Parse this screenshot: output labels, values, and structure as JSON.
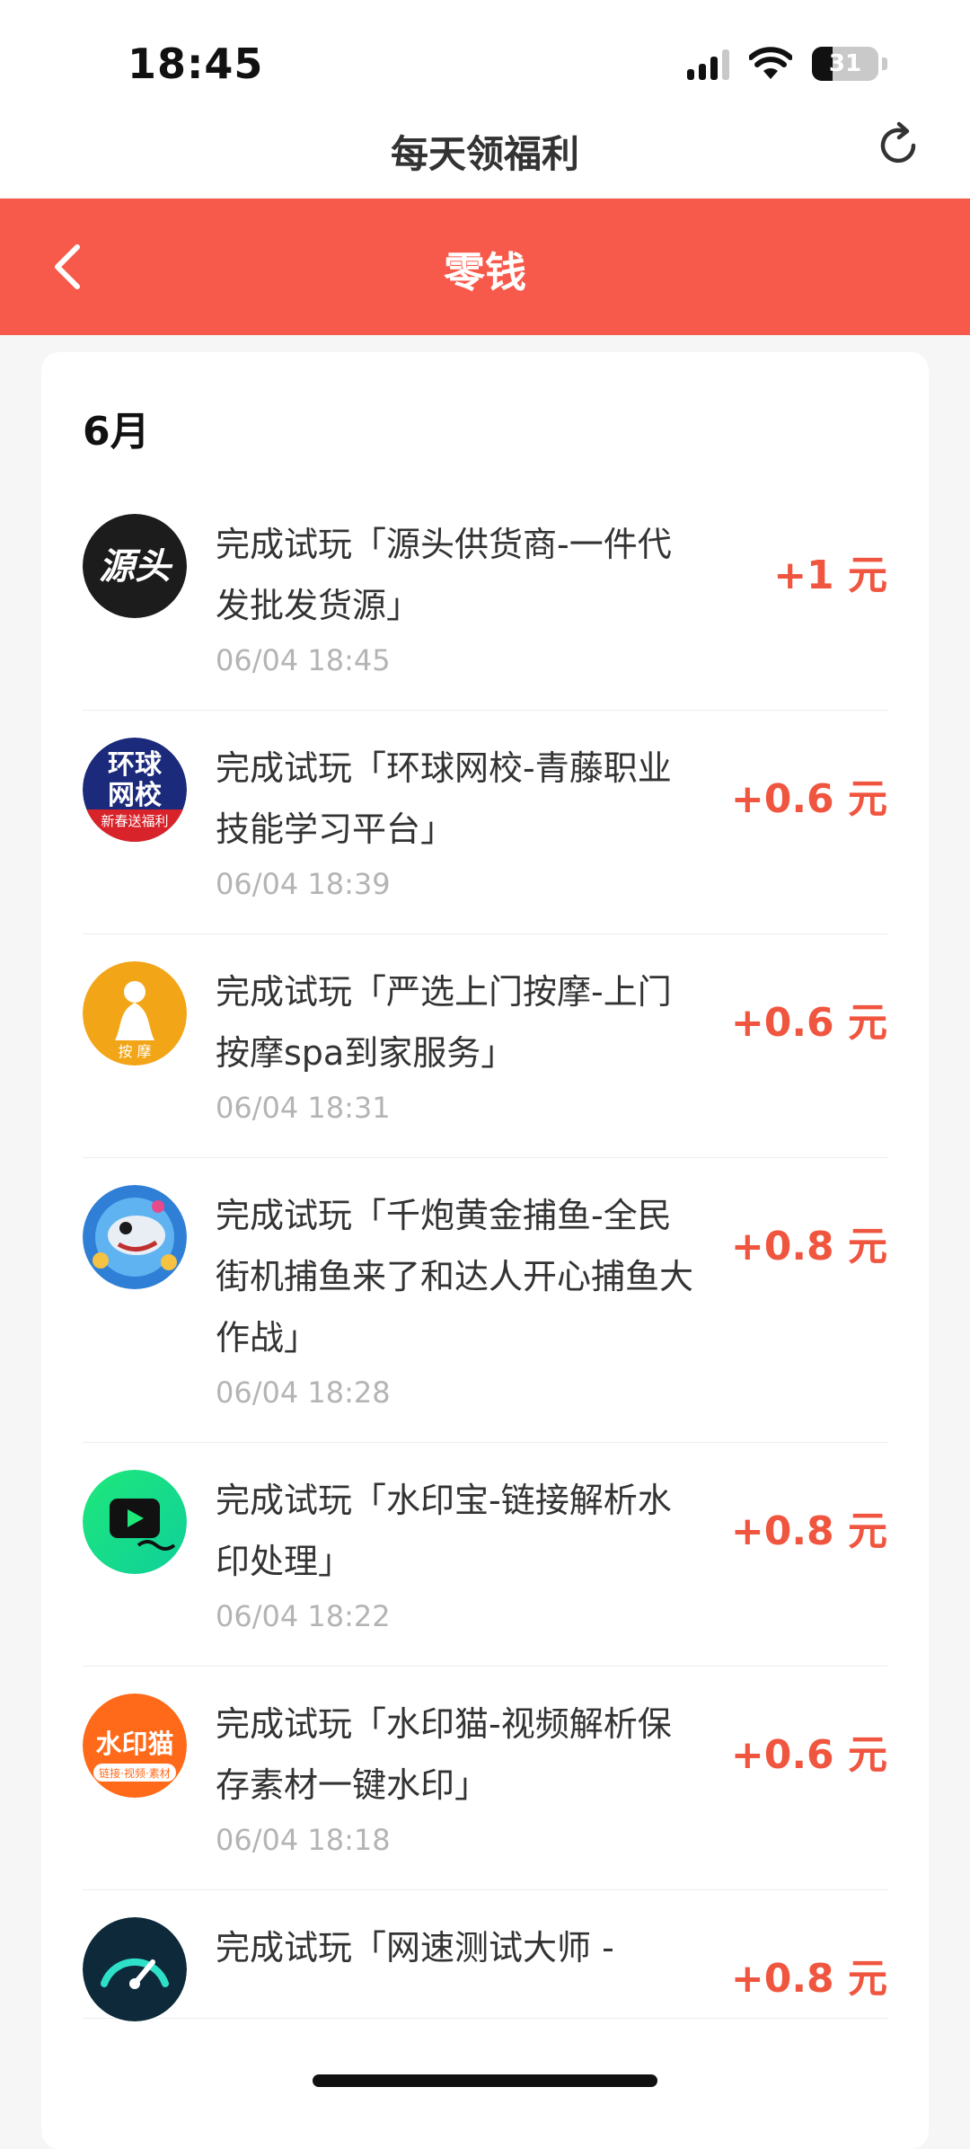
{
  "status": {
    "time": "18:45",
    "battery": "31",
    "battery_level": 0.31
  },
  "topbar": {
    "title": "每天领福利"
  },
  "header": {
    "title": "零钱",
    "color": "#f7594a"
  },
  "list": {
    "month": "6月",
    "items": [
      {
        "title": "完成试玩「源头供货商-一件代发批发货源」",
        "date": "06/04 18:45",
        "amount": "+1 元",
        "icon": "yuantou-app-icon"
      },
      {
        "title": "完成试玩「环球网校-青藤职业技能学习平台」",
        "date": "06/04 18:39",
        "amount": "+0.6 元",
        "icon": "huanqiu-wangxiao-app-icon"
      },
      {
        "title": "完成试玩「严选上门按摩-上门按摩spa到家服务」",
        "date": "06/04 18:31",
        "amount": "+0.6 元",
        "icon": "anmo-app-icon"
      },
      {
        "title": "完成试玩「千炮黄金捕鱼-全民街机捕鱼来了和达人开心捕鱼大作战」",
        "date": "06/04 18:28",
        "amount": "+0.8 元",
        "icon": "fishing-game-app-icon"
      },
      {
        "title": "完成试玩「水印宝-链接解析水印处理」",
        "date": "06/04 18:22",
        "amount": "+0.8 元",
        "icon": "shuiyinbao-app-icon"
      },
      {
        "title": "完成试玩「水印猫-视频解析保存素材一键水印」",
        "date": "06/04 18:18",
        "amount": "+0.6 元",
        "icon": "shuiyinmao-app-icon"
      },
      {
        "title": "完成试玩「网速测试大师 -",
        "date": "",
        "amount": "+0.8 元",
        "icon": "speedtest-app-icon"
      }
    ]
  },
  "icon_text": {
    "yuantou": "源头",
    "huanqiu_1": "环球",
    "huanqiu_2": "网校",
    "huanqiu_3": "新春送福利",
    "anmo": "按 摩",
    "shuiyinmao_1": "水印猫",
    "shuiyinmao_2": "链接·视频·素材"
  }
}
